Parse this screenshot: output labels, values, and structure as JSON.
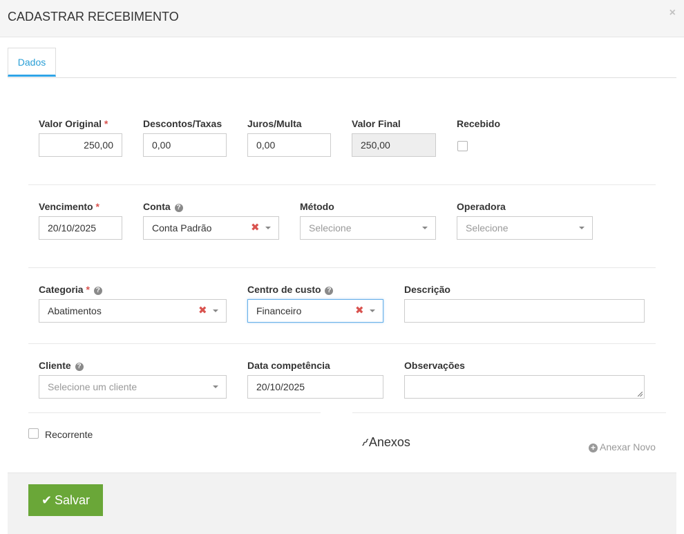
{
  "modal": {
    "title": "CADASTRAR RECEBIMENTO",
    "close": "×"
  },
  "tabs": [
    {
      "label": "Dados"
    }
  ],
  "row1": {
    "valor_original": {
      "label": "Valor Original",
      "required": "*",
      "value": "250,00"
    },
    "descontos": {
      "label": "Descontos/Taxas",
      "value": "0,00"
    },
    "juros": {
      "label": "Juros/Multa",
      "value": "0,00"
    },
    "valor_final": {
      "label": "Valor Final",
      "value": "250,00"
    },
    "recebido": {
      "label": "Recebido",
      "checked": false
    }
  },
  "row2": {
    "vencimento": {
      "label": "Vencimento",
      "required": "*",
      "value": "20/10/2025"
    },
    "conta": {
      "label": "Conta",
      "value": "Conta Padrão"
    },
    "metodo": {
      "label": "Método",
      "placeholder": "Selecione"
    },
    "operadora": {
      "label": "Operadora",
      "placeholder": "Selecione"
    }
  },
  "row3": {
    "categoria": {
      "label": "Categoria",
      "required": "*",
      "value": "Abatimentos"
    },
    "centro_custo": {
      "label": "Centro de custo",
      "value": "Financeiro"
    },
    "descricao": {
      "label": "Descrição",
      "value": ""
    }
  },
  "row4": {
    "cliente": {
      "label": "Cliente",
      "placeholder": "Selecione um cliente"
    },
    "data_competencia": {
      "label": "Data competência",
      "value": "20/10/2025"
    },
    "observacoes": {
      "label": "Observações",
      "value": ""
    }
  },
  "recorrente": {
    "label": "Recorrente",
    "checked": false
  },
  "anexos": {
    "title": "Anexos",
    "add_label": "Anexar Novo"
  },
  "footer": {
    "save_label": "Salvar"
  },
  "icons": {
    "help": "?",
    "clear": "✖",
    "check": "✔",
    "plus": "+",
    "clip": "📎"
  },
  "colors": {
    "accent": "#2a9fd6",
    "required": "#d9534f",
    "save": "#6aa738"
  }
}
